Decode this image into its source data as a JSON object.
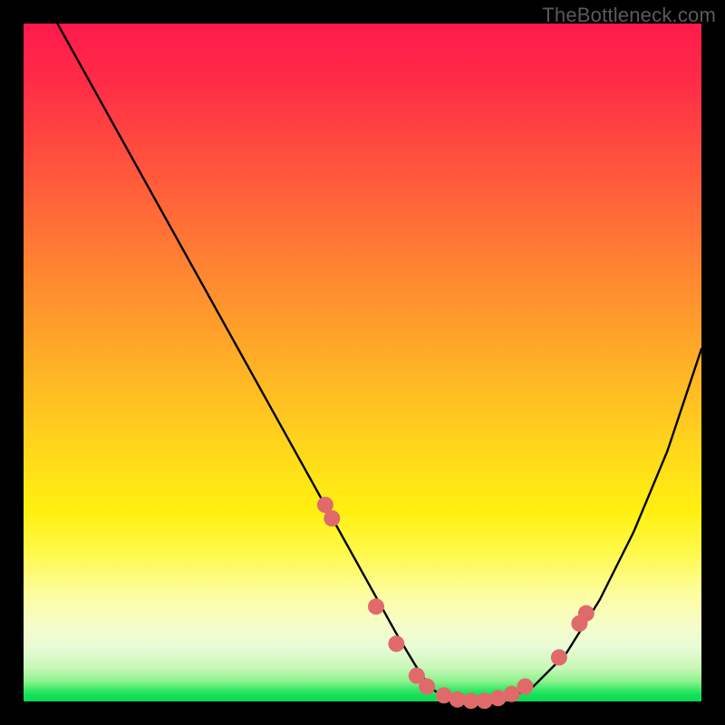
{
  "watermark": "TheBottleneck.com",
  "chart_data": {
    "type": "line",
    "title": "",
    "xlabel": "",
    "ylabel": "",
    "xlim": [
      0,
      100
    ],
    "ylim": [
      0,
      100
    ],
    "grid": false,
    "legend": false,
    "series": [
      {
        "name": "bottleneck-curve",
        "x": [
          0,
          5,
          10,
          15,
          20,
          25,
          30,
          35,
          40,
          45,
          50,
          55,
          58,
          60,
          62,
          65,
          68,
          72,
          75,
          80,
          85,
          90,
          95,
          100
        ],
        "y": [
          110,
          100,
          91,
          82,
          73,
          64,
          55,
          46,
          37,
          28,
          19,
          10,
          5,
          2,
          0.7,
          0,
          0,
          0.8,
          2,
          7,
          15,
          25,
          37,
          52
        ]
      }
    ],
    "markers": {
      "name": "highlight-points",
      "color": "#e06a6a",
      "radius": 9,
      "points": [
        {
          "x": 44.5,
          "y": 29
        },
        {
          "x": 45.5,
          "y": 27
        },
        {
          "x": 52,
          "y": 14
        },
        {
          "x": 55,
          "y": 8.5
        },
        {
          "x": 58,
          "y": 3.8
        },
        {
          "x": 59.5,
          "y": 2.2
        },
        {
          "x": 62,
          "y": 0.9
        },
        {
          "x": 64,
          "y": 0.3
        },
        {
          "x": 66,
          "y": 0.1
        },
        {
          "x": 68,
          "y": 0.1
        },
        {
          "x": 70,
          "y": 0.5
        },
        {
          "x": 72,
          "y": 1.1
        },
        {
          "x": 74,
          "y": 2.2
        },
        {
          "x": 79,
          "y": 6.5
        },
        {
          "x": 82,
          "y": 11.5
        },
        {
          "x": 83,
          "y": 13
        }
      ]
    }
  }
}
